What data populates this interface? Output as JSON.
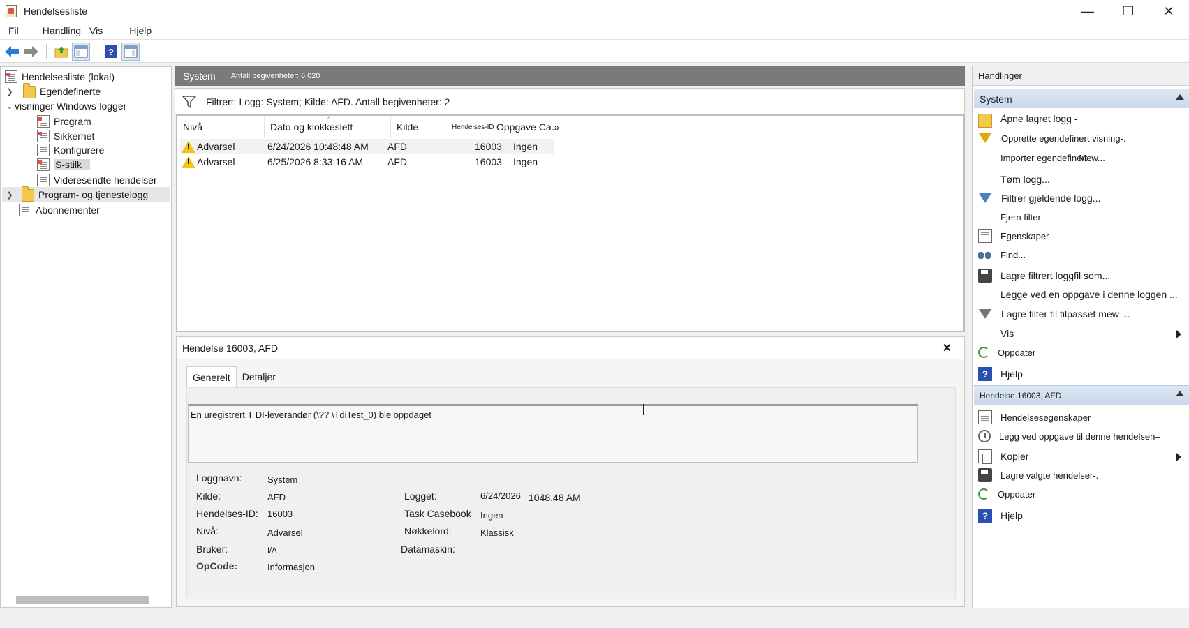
{
  "window": {
    "title": "Hendelsesliste",
    "controls": {
      "minimize": "—",
      "maximize": "❐",
      "close": "✕"
    }
  },
  "menu": [
    "Fil",
    "Handling",
    "Vis",
    "Hjelp"
  ],
  "toolbar": {
    "icons": [
      "back-arrow-icon",
      "forward-arrow-icon",
      "up-folder-icon",
      "show-hide-tree-icon",
      "help-icon",
      "show-hide-action-pane-icon"
    ]
  },
  "tree": {
    "root": "Hendelsesliste (lokal)",
    "custom_views": "Egendefinerte",
    "windows_logs": "visninger Windows-logger",
    "logs": [
      "Program",
      "Sikkerhet",
      "Konfigurere",
      "S-stilk",
      "Videresendte hendelser"
    ],
    "app_services": "Program- og tjenestelogg",
    "subscriptions": "Abonnementer"
  },
  "main": {
    "header_title": "System",
    "header_count": "Antall begivenheter: 6 020",
    "filter_text": "Filtrert: Logg: System; Kilde: AFD. Antall begivenheter: 2",
    "columns": [
      "Nivå",
      "Dato og klokkeslett",
      "Kilde",
      "Hendelses-ID",
      "Oppgave Ca.»"
    ],
    "rows": [
      {
        "level": "Advarsel",
        "datetime": "6/24/2026 10:48:48 AM",
        "source": "AFD",
        "id": "16003",
        "task": "Ingen"
      },
      {
        "level": "Advarsel",
        "datetime": "6/25/2026 8:33:16 AM",
        "source": "AFD",
        "id": "16003",
        "task": "Ingen"
      }
    ]
  },
  "detail": {
    "title": "Hendelse 16003, AFD",
    "tabs": [
      "Generelt",
      "Detaljer"
    ],
    "message": "En uregistrert T DI-leverandør (\\?? \\TdiTest_0) ble oppdaget",
    "labels": {
      "log_name": "Loggnavn:",
      "source": "Kilde:",
      "event_id": "Hendelses-ID:",
      "level": "Nivå:",
      "user": "Bruker:",
      "opcode": "OpCode:",
      "logged": "Logget:",
      "task_category": "Task Casebook",
      "keywords": "Nøkkelord:",
      "computer": "Datamaskin:"
    },
    "values": {
      "log_name": "System",
      "source": "AFD",
      "event_id": "16003",
      "level": "Advarsel",
      "user": "I/A",
      "opcode": "Informasjon",
      "logged_date": "6/24/2026",
      "logged_time": "1048.48 AM",
      "task_category": "Ingen",
      "keywords": "Klassisk",
      "computer": ""
    }
  },
  "actions": {
    "title": "Handlinger",
    "section1": "System",
    "items1": [
      {
        "label": "Åpne lagret logg -",
        "icon": "open-folder-icon"
      },
      {
        "label": "Opprette egendefinert visning-.",
        "icon": "funnel-icon"
      },
      {
        "label": "Importer egendefinert",
        "label2": "Mew...",
        "icon": ""
      },
      {
        "label": "Tøm logg...",
        "icon": ""
      },
      {
        "label": "Filtrer gjeldende logg...",
        "icon": "filter-icon"
      },
      {
        "label": "Fjern filter",
        "icon": ""
      },
      {
        "label": "Egenskaper",
        "icon": "properties-icon"
      },
      {
        "label": "Find...",
        "icon": "binoculars-icon"
      },
      {
        "label": "Lagre filtrert loggfil som...",
        "icon": "save-icon"
      },
      {
        "label": "Legge ved en oppgave i denne loggen ...",
        "icon": ""
      },
      {
        "label": "Lagre filter til tilpasset mew ...",
        "icon": "save-filter-icon"
      },
      {
        "label": "Vis",
        "icon": ""
      },
      {
        "label": "Oppdater",
        "icon": "refresh-icon"
      },
      {
        "label": "Hjelp",
        "icon": "help-icon"
      }
    ],
    "section2": "Hendelse 16003, AFD",
    "items2": [
      {
        "label": "Hendelsesegenskaper",
        "icon": "event-properties-icon"
      },
      {
        "label": "Legg ved oppgave til denne hendelsen–",
        "icon": "task-clock-icon"
      },
      {
        "label": "Kopier",
        "icon": "copy-icon"
      },
      {
        "label": "Lagre valgte hendelser-.",
        "icon": "save-icon"
      },
      {
        "label": "Oppdater",
        "icon": "refresh-icon"
      },
      {
        "label": "Hjelp",
        "icon": "help-icon"
      }
    ]
  }
}
